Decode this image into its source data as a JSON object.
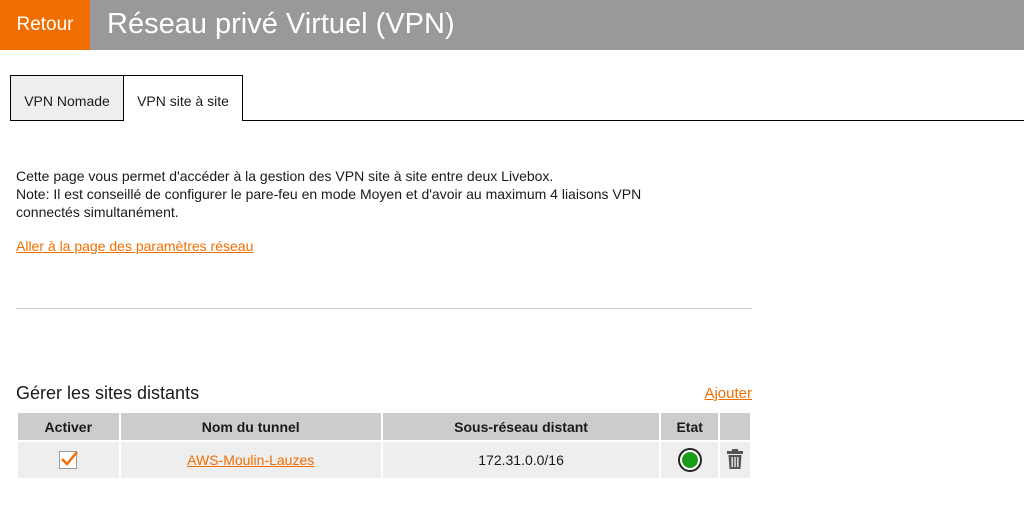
{
  "header": {
    "back_label": "Retour",
    "title": "Réseau privé Virtuel (VPN)"
  },
  "tabs": [
    {
      "label": "VPN Nomade",
      "active": false
    },
    {
      "label": "VPN site à site",
      "active": true
    }
  ],
  "intro": {
    "line1": "Cette page vous permet d'accéder à la gestion des VPN site à site entre deux Livebox.",
    "line2": "Note: Il est conseillé de configurer le pare-feu en mode Moyen et d'avoir au maximum 4 liaisons VPN",
    "line3": "connectés simultanément."
  },
  "network_link": "Aller à la page des paramètres réseau",
  "sites": {
    "title": "Gérer les sites distants",
    "add_label": "Ajouter",
    "columns": [
      "Activer",
      "Nom du tunnel",
      "Sous-réseau distant",
      "Etat"
    ],
    "rows": [
      {
        "active": true,
        "name": "AWS-Moulin-Lauzes",
        "subnet": "172.31.0.0/16",
        "status": "connected"
      }
    ]
  },
  "colors": {
    "accent": "#f16e00",
    "header_bg": "#999999",
    "status_ok": "#1a9c1a"
  }
}
